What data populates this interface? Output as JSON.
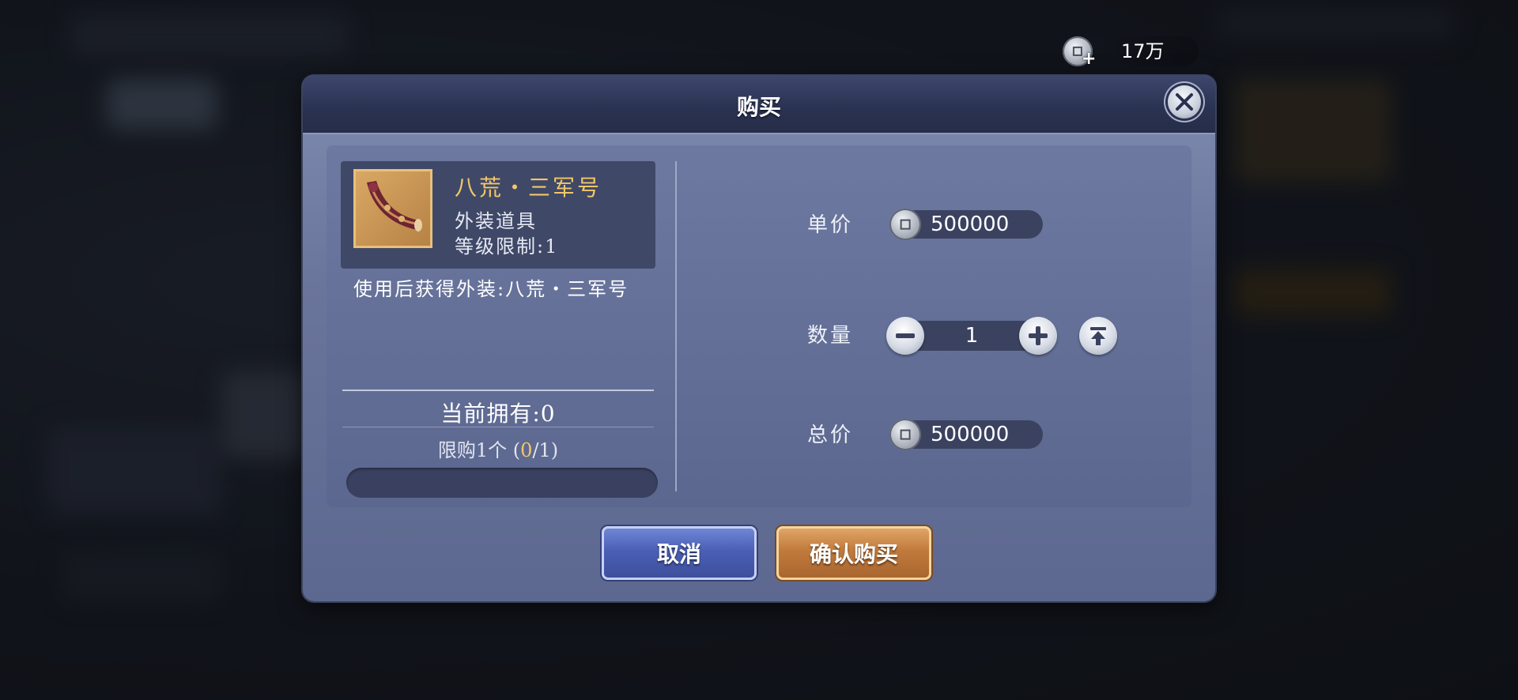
{
  "currency": {
    "amount": "17万",
    "icon": "coin-icon",
    "add_icon": "plus-icon"
  },
  "dialog": {
    "title": "购买",
    "item": {
      "name": "八荒・三军号",
      "type": "外装道具",
      "level": "等级限制:1",
      "description": "使用后获得外装:八荒・三军号",
      "icon": "horn-icon"
    },
    "owned": "当前拥有:0",
    "limit": {
      "prefix": "限购1个 (",
      "current": "0",
      "suffix": "/1)"
    },
    "purchase_progress": 0,
    "unit_price": {
      "label": "单价",
      "value": "500000"
    },
    "quantity": {
      "label": "数量",
      "value": "1"
    },
    "total_price": {
      "label": "总价",
      "value": "500000"
    },
    "buttons": {
      "cancel": "取消",
      "confirm": "确认购买"
    }
  },
  "colors": {
    "accent_gold": "#f2c768",
    "cancel_blue": "#4a5fb5",
    "confirm_orange": "#c07a3c"
  }
}
